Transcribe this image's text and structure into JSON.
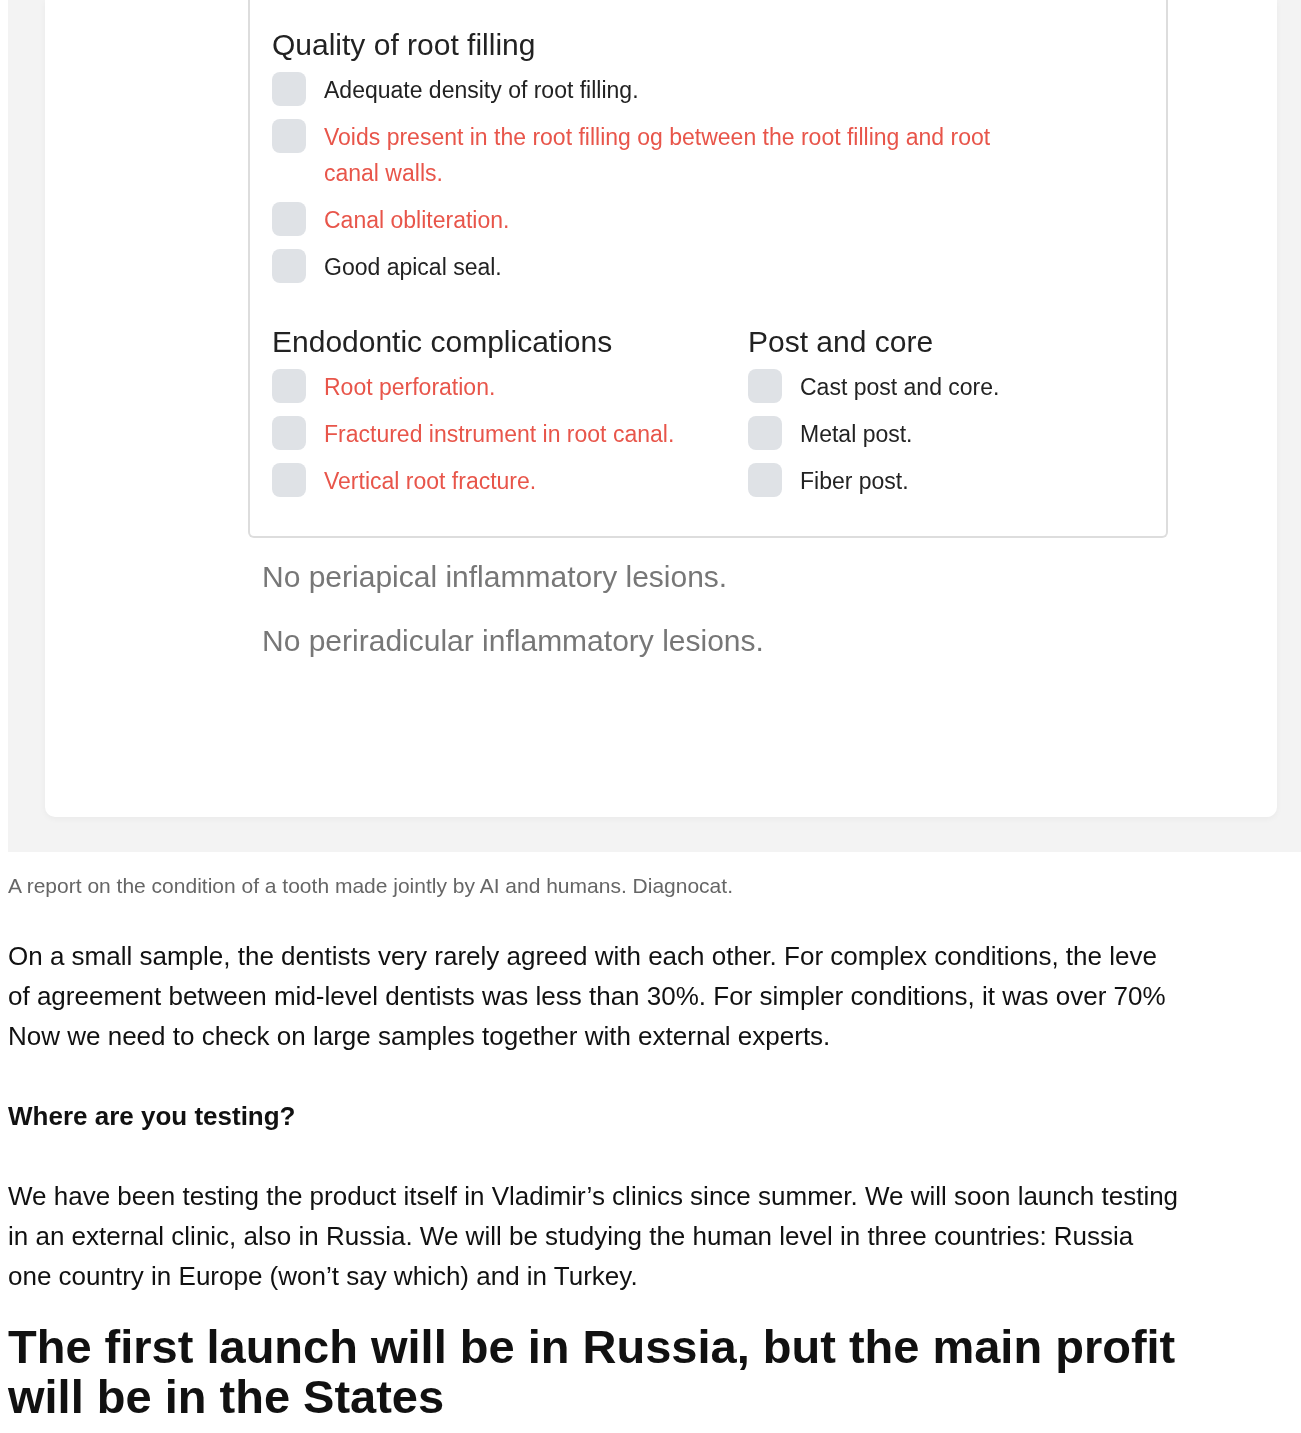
{
  "report": {
    "sections": [
      {
        "title": "Quality of root filling",
        "items": [
          {
            "label": "Adequate density of root filling.",
            "kind": "normal",
            "checked": false
          },
          {
            "label": "Voids present in the root filling og between the root filling and root canal walls.",
            "kind": "finding",
            "checked": false
          },
          {
            "label": "Canal obliteration.",
            "kind": "finding",
            "checked": false
          },
          {
            "label": "Good apical seal.",
            "kind": "normal",
            "checked": false
          }
        ]
      }
    ],
    "columns": [
      {
        "title": "Endodontic complications",
        "items": [
          {
            "label": "Root perforation.",
            "kind": "finding",
            "checked": false
          },
          {
            "label": "Fractured instrument in root canal.",
            "kind": "finding",
            "checked": false
          },
          {
            "label": "Vertical root fracture.",
            "kind": "finding",
            "checked": false
          }
        ]
      },
      {
        "title": "Post and core",
        "items": [
          {
            "label": "Cast post and core.",
            "kind": "normal",
            "checked": false
          },
          {
            "label": "Metal post.",
            "kind": "normal",
            "checked": false
          },
          {
            "label": "Fiber post.",
            "kind": "normal",
            "checked": false
          }
        ]
      }
    ],
    "conclusions": [
      "No periapical inflammatory lesions.",
      "No periradicular inflammatory lesions."
    ]
  },
  "caption": "A report on the condition of a tooth made jointly by AI and humans. Diagnocat.",
  "article": [
    {
      "kind": "paragraph",
      "lines": [
        "On a small sample, the dentists very rarely agreed with each other. For complex conditions, the leve",
        "of agreement between mid-level dentists was less than 30%. For simpler conditions, it was over 70%",
        "Now we need to check on large samples together with external experts."
      ]
    },
    {
      "kind": "subheading",
      "lines": [
        "Where are you testing?"
      ]
    },
    {
      "kind": "paragraph",
      "lines": [
        "We have been testing the product itself in Vladimir’s clinics since summer. We will soon launch testing",
        "in an external clinic, also in Russia. We will be studying the human level in three countries: Russia",
        "one country in Europe (won’t say which) and in Turkey."
      ]
    },
    {
      "kind": "heading",
      "lines": [
        "The first launch will be in Russia, but the main profit",
        "will be in the States"
      ]
    }
  ]
}
